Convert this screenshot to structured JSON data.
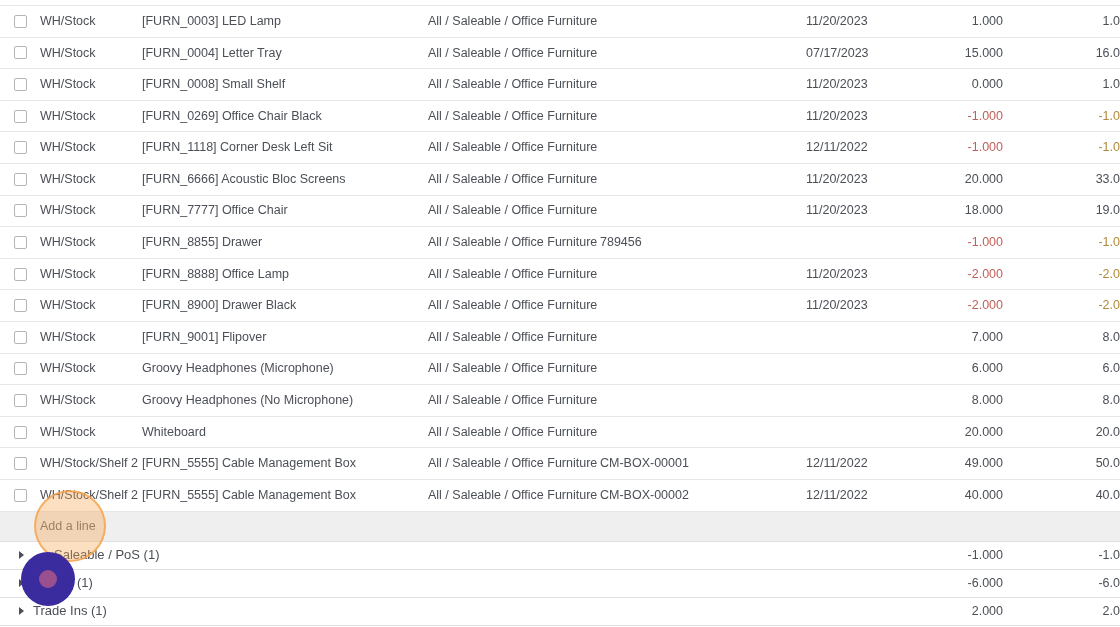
{
  "rows": [
    {
      "checked": false,
      "location": "WH/Stock",
      "product": "[FURN_0003] LED Lamp",
      "category": "All / Saleable / Office Furniture",
      "date": "11/20/2023",
      "quantity": "1.000",
      "column_7": "1.0",
      "negative": false
    },
    {
      "checked": false,
      "location": "WH/Stock",
      "product": "[FURN_0004] Letter Tray",
      "category": "All / Saleable / Office Furniture",
      "date": "07/17/2023",
      "quantity": "15.000",
      "column_7": "16.0",
      "negative": false
    },
    {
      "checked": false,
      "location": "WH/Stock",
      "product": "[FURN_0008] Small Shelf",
      "category": "All / Saleable / Office Furniture",
      "date": "11/20/2023",
      "quantity": "0.000",
      "column_7": "1.0",
      "negative": false
    },
    {
      "checked": false,
      "location": "WH/Stock",
      "product": "[FURN_0269] Office Chair Black",
      "category": "All / Saleable / Office Furniture",
      "date": "11/20/2023",
      "quantity": "-1.000",
      "column_7": "-1.0",
      "negative": true
    },
    {
      "checked": false,
      "location": "WH/Stock",
      "product": "[FURN_1118] Corner Desk Left Sit",
      "category": "All / Saleable / Office Furniture",
      "date": "12/11/2022",
      "quantity": "-1.000",
      "column_7": "-1.0",
      "negative": true
    },
    {
      "checked": false,
      "location": "WH/Stock",
      "product": "[FURN_6666] Acoustic Bloc Screens",
      "category": "All / Saleable / Office Furniture",
      "date": "11/20/2023",
      "quantity": "20.000",
      "column_7": "33.0",
      "negative": false
    },
    {
      "checked": false,
      "location": "WH/Stock",
      "product": "[FURN_7777] Office Chair",
      "category": "All / Saleable / Office Furniture",
      "date": "11/20/2023",
      "quantity": "18.000",
      "column_7": "19.0",
      "negative": false
    },
    {
      "checked": false,
      "location": "WH/Stock",
      "product": "[FURN_8855] Drawer",
      "category": "All / Saleable / Office Furniture",
      "lot": "789456",
      "quantity": "-1.000",
      "column_7": "-1.0",
      "negative": true
    },
    {
      "checked": false,
      "location": "WH/Stock",
      "product": "[FURN_8888] Office Lamp",
      "category": "All / Saleable / Office Furniture",
      "date": "11/20/2023",
      "quantity": "-2.000",
      "column_7": "-2.0",
      "negative": true
    },
    {
      "checked": false,
      "location": "WH/Stock",
      "product": "[FURN_8900] Drawer Black",
      "category": "All / Saleable / Office Furniture",
      "date": "11/20/2023",
      "quantity": "-2.000",
      "column_7": "-2.0",
      "negative": true
    },
    {
      "checked": false,
      "location": "WH/Stock",
      "product": "[FURN_9001] Flipover",
      "category": "All / Saleable / Office Furniture",
      "quantity": "7.000",
      "column_7": "8.0",
      "negative": false
    },
    {
      "checked": false,
      "location": "WH/Stock",
      "product": "Groovy Headphones (Microphone)",
      "category": "All / Saleable / Office Furniture",
      "quantity": "6.000",
      "column_7": "6.0",
      "negative": false
    },
    {
      "checked": false,
      "location": "WH/Stock",
      "product": "Groovy Headphones (No Microphone)",
      "category": "All / Saleable / Office Furniture",
      "quantity": "8.000",
      "column_7": "8.0",
      "negative": false
    },
    {
      "checked": false,
      "location": "WH/Stock",
      "product": "Whiteboard",
      "category": "All / Saleable / Office Furniture",
      "quantity": "20.000",
      "column_7": "20.0",
      "negative": false
    },
    {
      "checked": false,
      "location": "WH/Stock/Shelf 2",
      "product": "[FURN_5555] Cable Management Box",
      "category": "All / Saleable / Office Furniture",
      "lot": "CM-BOX-00001",
      "date": "12/11/2022",
      "quantity": "49.000",
      "column_7": "50.0",
      "negative": false
    },
    {
      "checked": false,
      "location": "WH/Stock/Shelf 2",
      "product": "[FURN_5555] Cable Management Box",
      "category": "All / Saleable / Office Furniture",
      "lot": "CM-BOX-00002",
      "date": "12/11/2022",
      "quantity": "40.000",
      "column_7": "40.0",
      "negative": false
    }
  ],
  "add_line": "Add a line",
  "groups": [
    {
      "label": "Saleable / PoS (1)",
      "expanded": false,
      "quantity": "-1.000",
      "column_7": "-1.0"
    },
    {
      "label": "(1)",
      "expanded": false,
      "quantity": "-6.000",
      "column_7": "-6.0"
    },
    {
      "label": "Trade Ins (1)",
      "expanded": false,
      "quantity": "2.000",
      "column_7": "2.0"
    }
  ]
}
